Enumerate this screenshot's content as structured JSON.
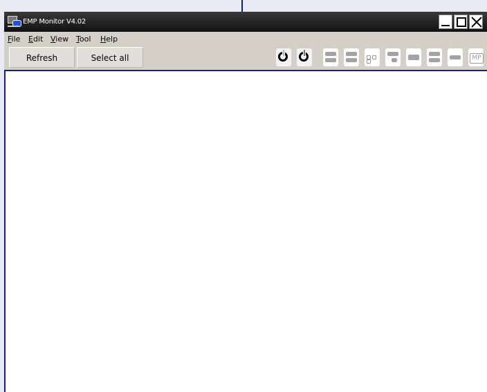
{
  "window": {
    "title": "EMP Monitor V4.02"
  },
  "menu": {
    "items": [
      {
        "label": "File",
        "underline": "F"
      },
      {
        "label": "Edit",
        "underline": "E"
      },
      {
        "label": "View",
        "underline": "V"
      },
      {
        "label": "Tool",
        "underline": "T"
      },
      {
        "label": "Help",
        "underline": "H"
      }
    ]
  },
  "toolbar": {
    "refresh_label": "Refresh",
    "select_all_label": "Select all",
    "mp_label": "MP"
  },
  "colors": {
    "callout": "#1a1a8c",
    "titlebar": "#1a1a1a"
  }
}
